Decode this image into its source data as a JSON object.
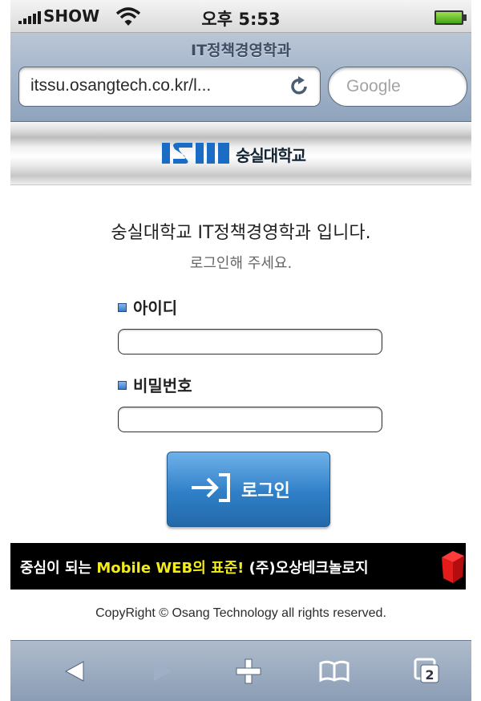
{
  "status_bar": {
    "carrier": "SHOW",
    "time": "오후 5:53"
  },
  "browser": {
    "page_title": "IT정책경영학과",
    "url": "itssu.osangtech.co.kr/l...",
    "search_placeholder": "Google"
  },
  "site": {
    "logo_text": "숭실대학교"
  },
  "login": {
    "headline": "숭실대학교 IT정책경영학과 입니다.",
    "subline": "로그인해 주세요.",
    "id_label": "아이디",
    "id_value": "",
    "pw_label": "비밀번호",
    "pw_value": "",
    "button_label": "로그인"
  },
  "banner": {
    "part1": "중심이 되는 ",
    "part2": "Mobile WEB의 표준!",
    "part3": " (주)오상테크놀로지"
  },
  "footer": {
    "copyright": "CopyRight © Osang Technology all rights reserved."
  },
  "toolbar": {
    "tabs_count": "2"
  },
  "colors": {
    "accent": "#2f7fc7",
    "banner_highlight": "#f3ec1a"
  }
}
